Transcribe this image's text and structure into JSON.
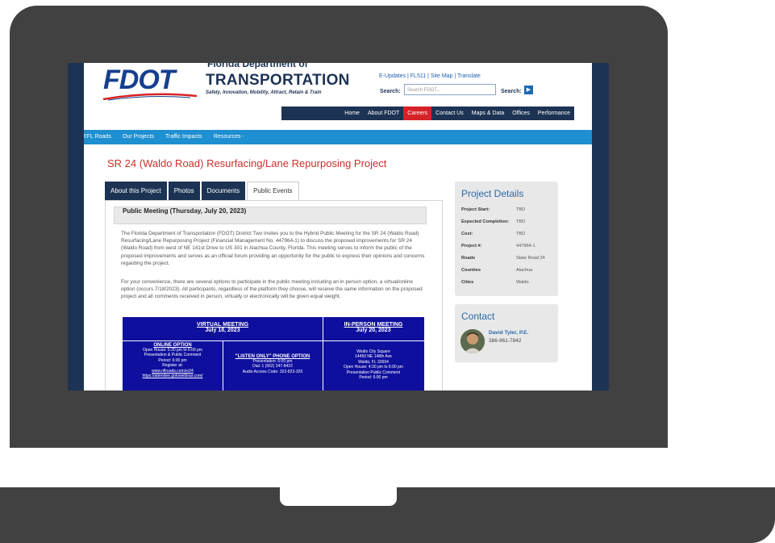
{
  "header": {
    "logo": "FDOT",
    "agency_top": "Florida Department of",
    "agency_main": "TRANSPORTATION",
    "tagline": "Safety, Innovation, Mobility, Attract, Retain & Train",
    "utility_links": "E-Updates | FL511 | Site Map | Translate",
    "search_label": "Search:",
    "search_placeholder": "Search FDOT...",
    "search_label2": "Search:",
    "search_go": "▶"
  },
  "top_nav": [
    "Home",
    "About FDOT",
    "Careers",
    "Contact Us",
    "Maps & Data",
    "Offices",
    "Performance"
  ],
  "blue_nav": [
    "NEFL Roads",
    "Our Projects",
    "Traffic Impacts",
    "Resources -"
  ],
  "page_title": "SR 24 (Waldo Road) Resurfacing/Lane Repurposing Project",
  "tabs": [
    "About this Project",
    "Photos",
    "Documents",
    "Public Events"
  ],
  "content": {
    "heading": "Public Meeting (Thursday, July 20, 2023)",
    "para1": "The Florida Department of Transportation (FDOT) District Two invites you to the Hybrid Public Meeting for the SR 24 (Waldo Road) Resurfacing/Lane Repurposing Project (Financial Management No. 447964-1) to discuss the proposed improvements for SR 24 (Waldo Road) from west of NE 141st Drive to US 301 in Alachua County, Florida. This meeting serves to inform the public of the proposed improvements and serves as an official forum providing an opportunity for the public to express their opinions and concerns regarding the project.",
    "para2": "For your convenience, there are several options to participate in the public meeting including an in person option, a virtual/online option (occurs 7/18/2023). All participants, regardless of the platform they choose, will receive the same information on the proposed project and all comments received in person, virtually or electronically will be given equal weight."
  },
  "meeting_table": {
    "virtual_title": "VIRTUAL MEETING",
    "virtual_date": "July 18, 2023",
    "inperson_title": "IN-PERSON MEETING",
    "inperson_date": "July 20, 2023",
    "online_title": "ONLINE OPTION",
    "online_lines": [
      "Open House: 5:30 pm to 6:00 pm",
      "Presentation & Public Comment",
      "Period: 6:00 pm",
      "Register at:",
      "www.nflroads.com/sr24",
      "https://attendee.gotowebinar.com/"
    ],
    "phone_title": "\"LISTEN ONLY\" PHONE OPTION",
    "phone_lines": [
      "Presentation: 6:00 pm",
      "Dial: 1 (562) 247-8422",
      "Audio Access Code: 322-823-320"
    ],
    "inperson_lines": [
      "Waldo City Square",
      "14450 NE 148th Ave",
      "Waldo, FL 32694",
      "Open House: 4:30 pm to 6:00 pm",
      "Presentation Public Comment",
      "Period: 6:00 pm"
    ]
  },
  "project_details": {
    "title": "Project Details",
    "rows": [
      {
        "label": "Project Start:",
        "value": "TBD"
      },
      {
        "label": "Expected Completion:",
        "value": "TBD"
      },
      {
        "label": "Cost:",
        "value": "TBD"
      },
      {
        "label": "Project #:",
        "value": "447964-1"
      },
      {
        "label": "Roads",
        "value": "State Road 24"
      },
      {
        "label": "Counties",
        "value": "Alachua"
      },
      {
        "label": "Cities",
        "value": "Waldo"
      }
    ]
  },
  "contact": {
    "title": "Contact",
    "name": "David Tyler, P.E.",
    "phone": "386-961-7842"
  },
  "colors": {
    "frame": "#414141",
    "navy": "#1d3354",
    "accent_red": "#d62226",
    "blue_bar": "#1e8fd0",
    "meeting_blue": "#0f0f9e"
  }
}
